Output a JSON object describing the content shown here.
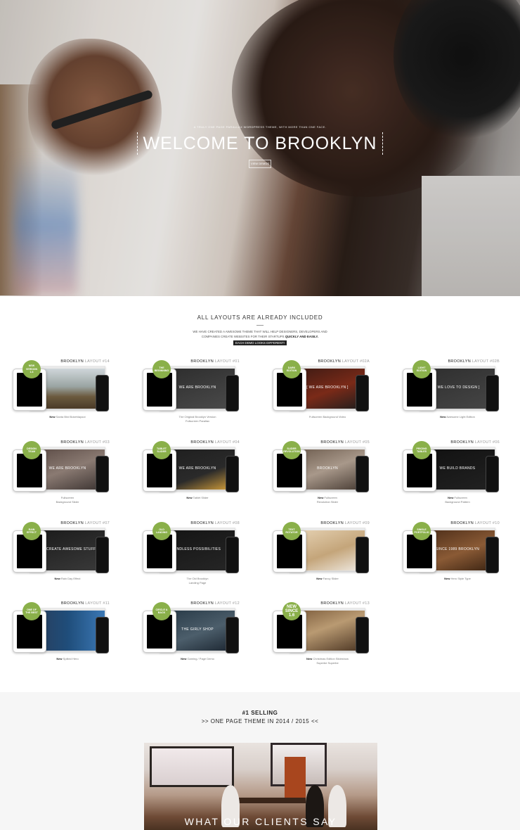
{
  "hero": {
    "tagline": "A truly one page parallax WordPress theme, with more than one face.",
    "title": "WELCOME TO BROOKLYN",
    "button": "View Demos"
  },
  "layouts": {
    "title": "ALL LAYOUTS ARE ALREADY INCLUDED",
    "desc_line1": "We have created a awesome theme that will help designers, developers and",
    "desc_line2_start": "companies create websites for their startups",
    "desc_line2_bold": "quickly and easily.",
    "badge": "Each demo looks different!",
    "cards": [
      {
        "brand": "BROOKLYN",
        "layout": "LAYOUT #14",
        "badge": "New Version 1.6",
        "caption_bold": "New",
        "caption": "Santa Bird Bokehlayout",
        "caption2": "",
        "screen_text": "",
        "screen_bg": "linear-gradient(180deg,#cfd6da 0%,#9aa4a2 45%,#6b5a3e 70%,#4a3a27 100%)"
      },
      {
        "brand": "BROOKLYN",
        "layout": "LAYOUT #01",
        "badge": "The Beginning",
        "caption_bold": "",
        "caption": "The Original Brooklyn Version",
        "caption2": "Fullscreen Parallax",
        "screen_text": "WE ARE BROOKLYN",
        "screen_bg": "linear-gradient(160deg,#2c2c2c,#4b4b4b)"
      },
      {
        "brand": "BROOKLYN",
        "layout": "LAYOUT #02A",
        "badge": "Dark Edition",
        "caption_bold": "",
        "caption": "Fullscreen Background Video",
        "caption2": "",
        "screen_text": "[ WE ARE BROOKLYN ]",
        "screen_bg": "linear-gradient(160deg,#3a1a14,#7a2a18 55%,#1e1e1e)"
      },
      {
        "brand": "BROOKLYN",
        "layout": "LAYOUT #02B",
        "badge": "Light Edition",
        "caption_bold": "New",
        "caption": "Awesome Light Edition",
        "caption2": "",
        "screen_text": "[ WE LOVE TO DESIGN ]",
        "screen_bg": "linear-gradient(160deg,#2e2e2e,#464646)"
      },
      {
        "brand": "BROOKLYN",
        "layout": "LAYOUT #03",
        "badge": "Design Team",
        "caption_bold": "",
        "caption": "Fullscreen",
        "caption2": "Background Slider",
        "screen_text": "WE ARE BROOKLYN",
        "screen_bg": "linear-gradient(160deg,#5a4a44,#8a7a72 50%,#3a3230)"
      },
      {
        "brand": "BROOKLYN",
        "layout": "LAYOUT #04",
        "badge": "Tablet Slider",
        "caption_bold": "New",
        "caption": "Tablet Slider",
        "caption2": "",
        "screen_text": "WE ARE BROOKLYN",
        "screen_bg": "linear-gradient(160deg,#1e1e1e,#2a2a2a 60%,#d9a23a)"
      },
      {
        "brand": "BROOKLYN",
        "layout": "LAYOUT #05",
        "badge": "Slider Revolution",
        "caption_bold": "New",
        "caption": "Fullscreen",
        "caption2": "Revolution Slider",
        "screen_text": "BROOKLYN",
        "screen_bg": "linear-gradient(160deg,#6b5a4c,#a8988a 50%,#463a32)"
      },
      {
        "brand": "BROOKLYN",
        "layout": "LAYOUT #06",
        "badge": "Pricing Tables",
        "caption_bold": "New",
        "caption": "Fullscreen",
        "caption2": "Background Pattern",
        "screen_text": "WE BUILD BRANDS",
        "screen_bg": "linear-gradient(160deg,#111,#222)"
      },
      {
        "brand": "BROOKLYN",
        "layout": "LAYOUT #07",
        "badge": "Rain Effect",
        "caption_bold": "New",
        "caption": "Rain Day Effect",
        "caption2": "",
        "screen_text": "WE CREATE AWESOME STUFF",
        "screen_bg": "linear-gradient(160deg,#1a1a1a,#3a3a3a)"
      },
      {
        "brand": "BROOKLYN",
        "layout": "LAYOUT #08",
        "badge": "Old Landing",
        "caption_bold": "",
        "caption": "The Old Brooklyn",
        "caption2": "Landing Page",
        "screen_text": "ENDLESS POSSIBILITIES",
        "screen_bg": "linear-gradient(160deg,#141414,#262626)"
      },
      {
        "brand": "BROOKLYN",
        "layout": "LAYOUT #09",
        "badge": "Text Rotator",
        "caption_bold": "New",
        "caption": "Fancy Slider",
        "caption2": "",
        "screen_text": "",
        "screen_bg": "linear-gradient(160deg,#e7d4b6,#c4a57a 55%,#f0ebe4)"
      },
      {
        "brand": "BROOKLYN",
        "layout": "LAYOUT #10",
        "badge": "Single Portfolio",
        "caption_bold": "New",
        "caption": "Hero Style Type",
        "caption2": "",
        "screen_text": "SINCE 1989 BROOKLYN",
        "screen_bg": "linear-gradient(160deg,#4a2c18,#8a5a35 55%,#3a2312)"
      },
      {
        "brand": "BROOKLYN",
        "layout": "LAYOUT #11",
        "badge": "One of the best",
        "caption_bold": "New",
        "caption": "Splited Hero",
        "caption2": "",
        "screen_text": "",
        "screen_bg": "linear-gradient(90deg,#2a3b57,#1f4d7a 50%,#3b78b5)"
      },
      {
        "brand": "BROOKLYN",
        "layout": "LAYOUT #12",
        "badge": "Circle & Back",
        "caption_bold": "New",
        "caption": "Gaming / Page Demo",
        "caption2": "",
        "screen_text": "THE GIRLY SHOP",
        "screen_bg": "linear-gradient(160deg,#263845,#4c5e6b 55%,#1b2530)"
      },
      {
        "brand": "BROOKLYN",
        "layout": "LAYOUT #13",
        "badge": "New Since 1.6",
        "caption_bold": "New",
        "caption": "Christmas Edition Slideshow",
        "caption2": "Superbe Superbe",
        "screen_text": "",
        "screen_bg": "linear-gradient(160deg,#7a5a3a,#b99a72 45%,#4a3422)",
        "big_badge": true
      }
    ]
  },
  "selling": {
    "line1": "#1 SELLING",
    "line2": ">> ONE PAGE THEME IN 2014 / 2015 <<",
    "clients_title": "WHAT OUR CLIENTS SAY"
  }
}
